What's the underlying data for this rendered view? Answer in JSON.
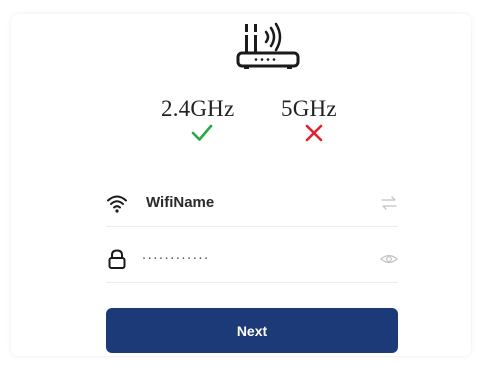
{
  "bands": {
    "band_24": {
      "label": "2.4GHz",
      "supported": true,
      "color": "#27a844"
    },
    "band_5": {
      "label": "5GHz",
      "supported": false,
      "color": "#e2232f"
    }
  },
  "wifi": {
    "ssid": "WifiName",
    "password_masked": "············"
  },
  "icons": {
    "router": "router-icon",
    "wifi": "wifi-icon",
    "lock": "lock-icon",
    "switch": "switch-arrows-icon",
    "eye": "eye-icon"
  },
  "actions": {
    "next_label": "Next",
    "accent": "#1d3a78"
  }
}
